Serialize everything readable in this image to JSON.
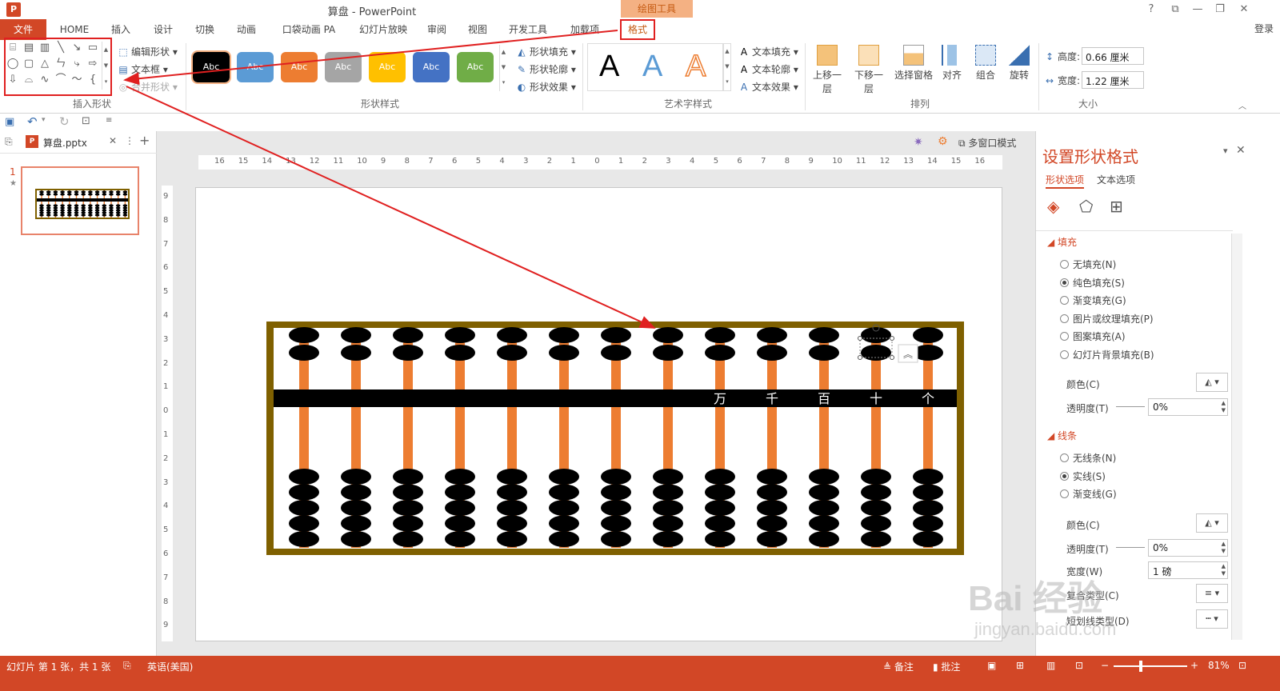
{
  "window": {
    "title": "算盘 - PowerPoint",
    "context_group": "绘图工具",
    "help": "?",
    "signin": "登录"
  },
  "tabs": [
    {
      "label": "文件"
    },
    {
      "label": "HOME"
    },
    {
      "label": "插入"
    },
    {
      "label": "设计"
    },
    {
      "label": "切换"
    },
    {
      "label": "动画"
    },
    {
      "label": "口袋动画 PA"
    },
    {
      "label": "幻灯片放映"
    },
    {
      "label": "审阅"
    },
    {
      "label": "视图"
    },
    {
      "label": "开发工具"
    },
    {
      "label": "加载项"
    },
    {
      "label": "格式"
    }
  ],
  "ribbon": {
    "insert_shapes": {
      "label": "插入形状",
      "edit_shape": "编辑形状",
      "text_box": "文本框",
      "merge_shapes": "合并形状"
    },
    "shape_styles": {
      "label": "形状样式",
      "swatch_text": "Abc",
      "swatches": [
        "#000000",
        "#5b9bd5",
        "#ed7d31",
        "#a5a5a5",
        "#ffc000",
        "#4472c4",
        "#70ad47"
      ],
      "fill": "形状填充",
      "outline": "形状轮廓",
      "effects": "形状效果"
    },
    "wordart": {
      "label": "艺术字样式",
      "letter": "A",
      "text_fill": "文本填充",
      "text_outline": "文本轮廓",
      "text_effects": "文本效果"
    },
    "arrange": {
      "label": "排列",
      "bring_forward": "上移一层",
      "send_backward": "下移一层",
      "selection_pane": "选择窗格",
      "align": "对齐",
      "group": "组合",
      "rotate": "旋转"
    },
    "size": {
      "label": "大小",
      "height_label": "高度:",
      "height_value": "0.66 厘米",
      "width_label": "宽度:",
      "width_value": "1.22 厘米"
    }
  },
  "file_tab": {
    "name": "算盘.pptx",
    "multi_window": "多窗口模式"
  },
  "slides": {
    "number": "1",
    "star": "★"
  },
  "ruler": {
    "h_ticks": [
      "16",
      "15",
      "14",
      "13",
      "12",
      "11",
      "10",
      "9",
      "8",
      "7",
      "6",
      "5",
      "4",
      "3",
      "2",
      "1",
      "0",
      "1",
      "2",
      "3",
      "4",
      "5",
      "6",
      "7",
      "8",
      "9",
      "10",
      "11",
      "12",
      "13",
      "14",
      "15",
      "16"
    ],
    "v_ticks": [
      "9",
      "8",
      "7",
      "6",
      "5",
      "4",
      "3",
      "2",
      "1",
      "0",
      "1",
      "2",
      "3",
      "4",
      "5",
      "6",
      "7",
      "8",
      "9"
    ]
  },
  "abacus": {
    "place_labels": [
      "万",
      "千",
      "百",
      "十",
      "个"
    ],
    "rod_count": 13,
    "frame_color": "#7f6000",
    "rod_color": "#ed7d31"
  },
  "format_pane": {
    "title": "设置形状格式",
    "tab_shape": "形状选项",
    "tab_text": "文本选项",
    "fill_section": "填充",
    "fill_options": [
      "无填充(N)",
      "纯色填充(S)",
      "渐变填充(G)",
      "图片或纹理填充(P)",
      "图案填充(A)",
      "幻灯片背景填充(B)"
    ],
    "fill_selected": 1,
    "color_label": "颜色(C)",
    "transparency_label": "透明度(T)",
    "fill_transparency": "0%",
    "line_section": "线条",
    "line_options": [
      "无线条(N)",
      "实线(S)",
      "渐变线(G)"
    ],
    "line_selected": 1,
    "line_color_label": "颜色(C)",
    "line_transparency_label": "透明度(T)",
    "line_transparency": "0%",
    "width_label": "宽度(W)",
    "width_value": "1 磅",
    "compound_label": "复合类型(C)",
    "dash_label": "短划线类型(D)"
  },
  "status": {
    "slide_info": "幻灯片 第 1 张，共 1 张",
    "language": "英语(美国)",
    "notes": "备注",
    "comments": "批注",
    "zoom": "81%"
  },
  "watermark": {
    "brand": "Bai 经验",
    "url": "jingyan.baidu.com"
  }
}
